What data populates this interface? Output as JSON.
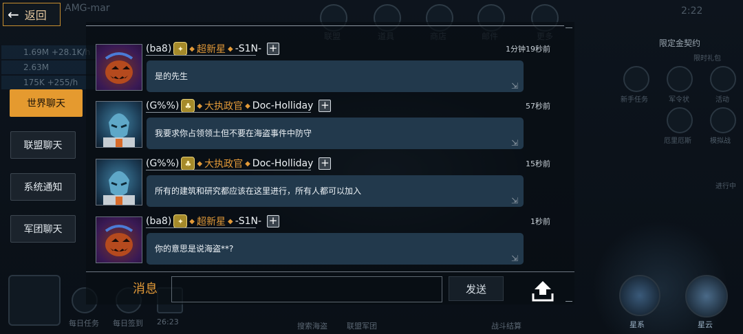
{
  "window": {
    "player_name": "AMG-mar"
  },
  "back_button": {
    "label": "返回"
  },
  "tabs": [
    {
      "label": "世界聊天",
      "active": true
    },
    {
      "label": "联盟聊天",
      "active": false
    },
    {
      "label": "系统通知",
      "active": false
    },
    {
      "label": "军团聊天",
      "active": false
    }
  ],
  "messages": [
    {
      "tag": "(ba8)",
      "title": "超新星",
      "name": "-S1N-",
      "time": "1分钟19秒前",
      "text": "是的先生",
      "avatar": "pumpkin-avatar"
    },
    {
      "tag": "(G%%)",
      "title": "大执政官",
      "name": "Doc-Holliday",
      "time": "57秒前",
      "text": "我要求你占领领土但不要在海盗事件中防守",
      "avatar": "alien-avatar"
    },
    {
      "tag": "(G%%)",
      "title": "大执政官",
      "name": "Doc-Holliday",
      "time": "15秒前",
      "text": "所有的建筑和研究都应该在这里进行，所有人都可以加入",
      "avatar": "alien-avatar"
    },
    {
      "tag": "(ba8)",
      "title": "超新星",
      "name": "-S1N-",
      "time": "1秒前",
      "text": "你的意思是说海盗**?",
      "avatar": "pumpkin-avatar"
    }
  ],
  "input": {
    "label": "消息",
    "value": "",
    "send_label": "发送"
  },
  "background": {
    "top_labels": [
      "联盟",
      "道具",
      "商店",
      "邮件",
      "更多"
    ],
    "resources": [
      "1.69M +28.1K/h",
      "2.63M",
      "175K +255/h"
    ],
    "right_labels": [
      "新手任务",
      "军令状",
      "活动",
      "厄里厄斯",
      "模拟战",
      "限定金契约",
      "限时礼包",
      "进行中"
    ],
    "bottom_labels": [
      "每日任务",
      "每日签到",
      "搜索海盗",
      "联盟军团",
      "战斗结算",
      "星系",
      "星云"
    ],
    "timer": "26:23",
    "clock": "2:22"
  },
  "colors": {
    "accent": "#e59a2f",
    "bubble": "#22394c",
    "title_orange": "#e39a38"
  }
}
